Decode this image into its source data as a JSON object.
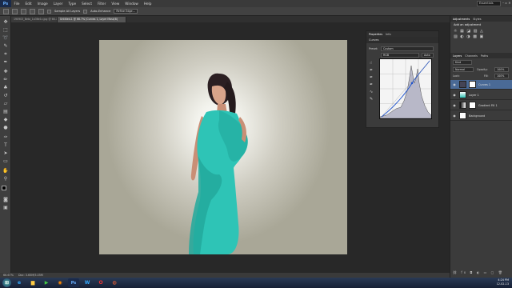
{
  "app": {
    "logo": "Ps",
    "menu": [
      "File",
      "Edit",
      "Image",
      "Layer",
      "Type",
      "Select",
      "Filter",
      "View",
      "Window",
      "Help"
    ],
    "workspace": "Essentials",
    "window_controls": "– ▫ ✕"
  },
  "options_bar": {
    "sample_all_layers": "Sample All Layers",
    "auto_enhance": "Auto-Enhance",
    "refine_edge": "Refine Edge..."
  },
  "document_tabs": [
    "190903_Beta_1a36e1c.jpg @ 66.7% (RGB/8#)",
    "Untitled-1 @ 66.7% (Curves 1, Layer Mask/8)"
  ],
  "status": {
    "zoom": "66.67%",
    "doc": "Doc: 3.65M/5.05M"
  },
  "adjustments_panel": {
    "tabs": [
      "Adjustments",
      "Styles"
    ],
    "heading": "Add an adjustment"
  },
  "properties_panel": {
    "tabs": [
      "Properties",
      "Info"
    ],
    "title": "Curves",
    "preset_label": "Preset:",
    "preset_value": "Custom",
    "channel_value": "RGB",
    "auto_label": "Auto"
  },
  "layers_panel": {
    "tabs": [
      "Layers",
      "Channels",
      "Paths"
    ],
    "kind": "Kind",
    "blend_mode": "Normal",
    "opacity_label": "Opacity:",
    "opacity_value": "100%",
    "lock_label": "Lock:",
    "fill_label": "Fill:",
    "fill_value": "100%",
    "layers": [
      {
        "name": "Curves 1",
        "selected": true
      },
      {
        "name": "Layer 1",
        "selected": false
      },
      {
        "name": "Gradient Fill 1",
        "selected": false
      },
      {
        "name": "Background",
        "selected": false
      }
    ]
  },
  "taskbar": {
    "time": "4:24 PM",
    "date": "12-02-13"
  },
  "colors": {
    "dress": "#2ec4b6",
    "selection": "#4a6a96"
  }
}
